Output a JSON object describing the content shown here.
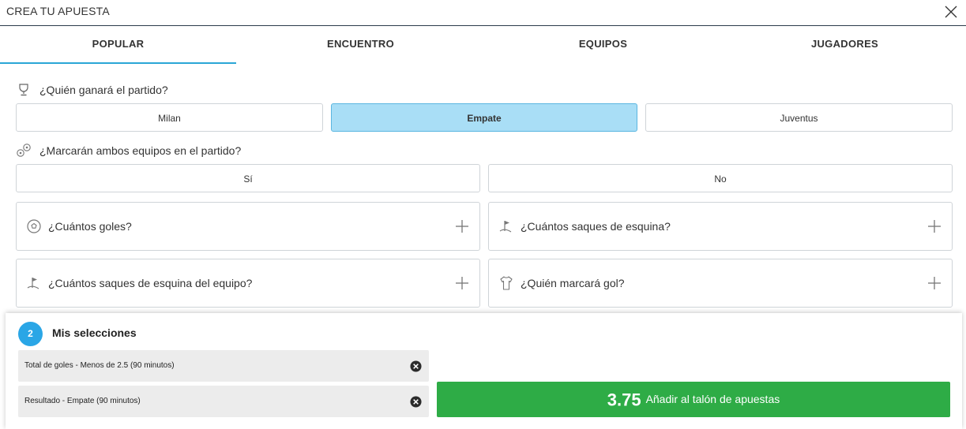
{
  "header": {
    "title": "CREA TU APUESTA"
  },
  "tabs": [
    {
      "label": "POPULAR",
      "active": true
    },
    {
      "label": "ENCUENTRO"
    },
    {
      "label": "EQUIPOS"
    },
    {
      "label": "JUGADORES"
    }
  ],
  "winner_question": {
    "label": "¿Quién ganará el partido?",
    "icon": "trophy-icon",
    "options": [
      "Milan",
      "Empate",
      "Juventus"
    ],
    "selected": "Empate"
  },
  "btts_question": {
    "label": "¿Marcarán ambos equipos en el partido?",
    "icon": "balls-icon",
    "options": [
      "Sí",
      "No"
    ]
  },
  "market_cards": [
    {
      "label": "¿Cuántos goles?",
      "icon": "soccer-ball-icon"
    },
    {
      "label": "¿Cuántos saques de esquina?",
      "icon": "corner-flag-icon"
    },
    {
      "label": "¿Cuántos saques de esquina del equipo?",
      "icon": "corner-flag-icon"
    },
    {
      "label": "¿Quién marcará gol?",
      "icon": "shirt-icon"
    }
  ],
  "selections": {
    "count": "2",
    "title": "Mis selecciones",
    "items": [
      {
        "text": "Total de goles - Menos de 2.5 (90 minutos)"
      },
      {
        "text": "Resultado - Empate (90 minutos)"
      }
    ],
    "odds": "3.75",
    "add_label": "Añadir al talón de apuestas"
  },
  "colors": {
    "accent": "#2aa6d6",
    "selected_bg": "#a9def6",
    "add_button": "#2eac46",
    "badge": "#2aa6e6"
  }
}
